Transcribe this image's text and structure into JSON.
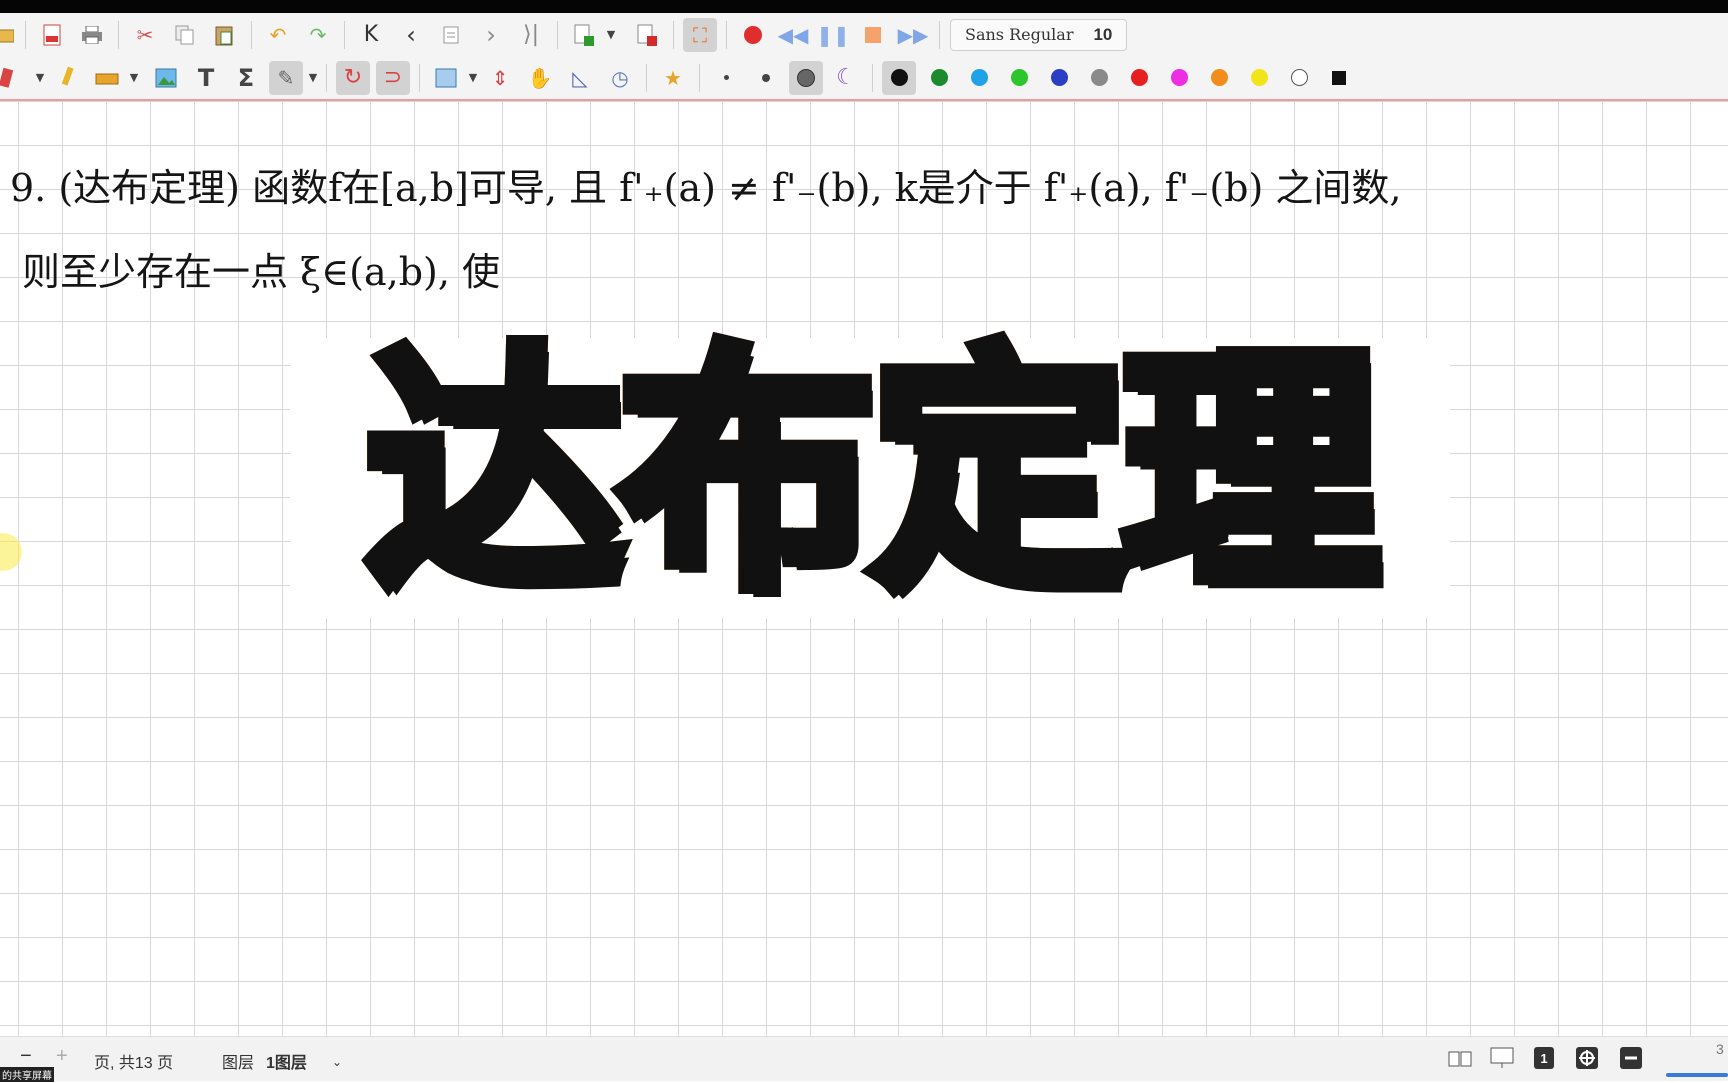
{
  "toolbar_top": {
    "font_name": "Sans Regular",
    "font_size": "10"
  },
  "toolbar_colors": {
    "colors": [
      "#111111",
      "#1e8a2e",
      "#1fa3e6",
      "#2cc52c",
      "#2b3fc4",
      "#8a8a8a",
      "#e62020",
      "#ee2ee2",
      "#f28c1a",
      "#f2e41a",
      "#ffffff",
      "#111111"
    ]
  },
  "handwriting": {
    "line1": "9. (达布定理) 函数f在[a,b]可导, 且 f'₊(a) ≠ f'₋(b), k是介于 f'₊(a), f'₋(b) 之间数,",
    "line2": "则至少存在一点 ξ∈(a,b), 使"
  },
  "banner": {
    "title": "达布定理"
  },
  "statusbar": {
    "minus": "−",
    "plus": "+",
    "page_text": "页, 共13 页",
    "layer_label": "图层",
    "layer_value": "1图层",
    "layer_caret": "⌄",
    "corner_number": "3",
    "share_label": "的共享屏幕"
  }
}
